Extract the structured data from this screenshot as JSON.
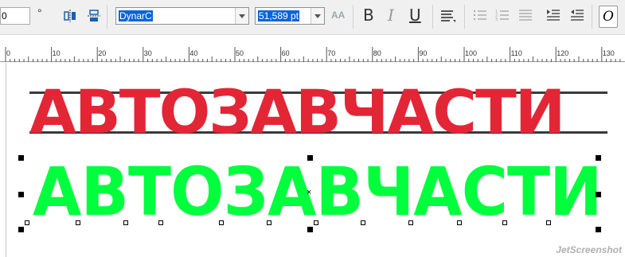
{
  "toolbar": {
    "angle_value": "0",
    "angle_unit": "°",
    "font_family": "DynarC",
    "font_size": "51,589 pt",
    "aa_label": "AA",
    "bold_label": "B",
    "italic_label": "I",
    "underline_label": "U",
    "last_button_label": "O"
  },
  "ruler": {
    "labels": [
      "0",
      "10",
      "20",
      "30",
      "40",
      "50",
      "60",
      "70",
      "80",
      "90",
      "100",
      "110",
      "120",
      "130"
    ]
  },
  "canvas": {
    "logo_text": "АВТОЗАВЧАСТИ",
    "traced_text": "АВТОЗАВЧАСТИ",
    "logo_color": "#e32636",
    "traced_color": "#00ff3c"
  },
  "watermark": "JetScreenshot"
}
